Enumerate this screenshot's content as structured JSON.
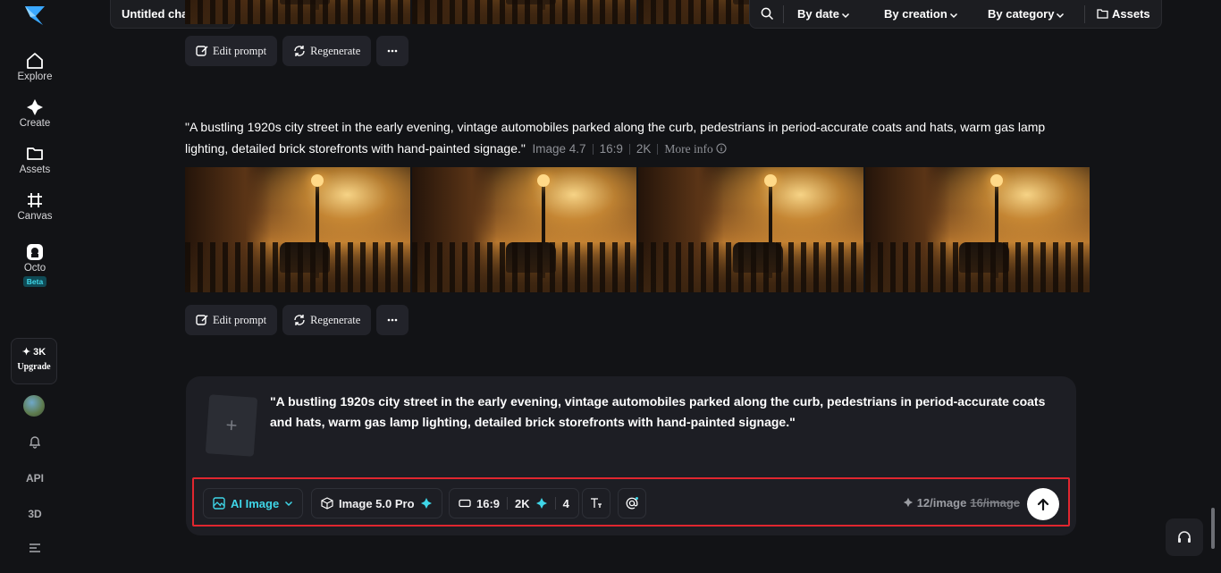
{
  "sidebar": {
    "items": [
      {
        "label": "Explore",
        "icon": "home-icon"
      },
      {
        "label": "Create",
        "icon": "sparkle-icon"
      },
      {
        "label": "Assets",
        "icon": "folder-icon"
      },
      {
        "label": "Canvas",
        "icon": "canvas-icon"
      },
      {
        "label": "Octo",
        "icon": "octo-icon"
      }
    ],
    "octo_badge": "Beta",
    "upgrade": {
      "credits": "✦ 3K",
      "label": "Upgrade"
    },
    "api_label": "API",
    "threed_label": "3D"
  },
  "header": {
    "chat_title": "Untitled chat",
    "filters": {
      "by_date": "By date",
      "by_creation": "By creation",
      "by_category": "By category",
      "assets": "Assets"
    }
  },
  "generation": {
    "prompt": "\"A bustling 1920s city street in the early evening, vintage automobiles parked along the curb, pedestrians in period-accurate coats and hats, warm gas lamp lighting, detailed brick storefronts with hand-painted signage.\"",
    "model": "Image 4.7",
    "ratio": "16:9",
    "resolution": "2K",
    "more_info": "More info"
  },
  "actions": {
    "edit_prompt": "Edit prompt",
    "regenerate": "Regenerate"
  },
  "composer": {
    "text": "\"A bustling 1920s city street in the early evening, vintage automobiles parked along the curb, pedestrians in period-accurate coats and hats, warm gas lamp lighting, detailed brick storefronts with hand-painted signage.\"",
    "mode": "AI Image",
    "model": "Image 5.0 Pro",
    "ratio": "16:9",
    "resolution": "2K",
    "count": "4",
    "price": "12/image",
    "old_price": "16/image"
  },
  "colors": {
    "accent": "#3fd6e8",
    "highlight_border": "#e0262f",
    "background": "#121316"
  }
}
